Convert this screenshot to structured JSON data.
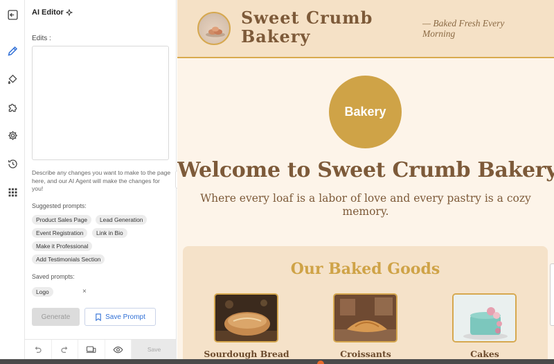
{
  "panel": {
    "title": "AI Editor",
    "edits_label": "Edits :",
    "edits_value": "",
    "help_text": "Describe any changes you want to make to the page here, and our AI Agent will make the changes for you!",
    "suggested_label": "Suggested prompts:",
    "suggested": [
      "Product Sales Page",
      "Lead Generation",
      "Event Registration",
      "Link in Bio",
      "Make it Professional",
      "Add Testimonials Section"
    ],
    "saved_label": "Saved prompts:",
    "saved": [
      "Logo"
    ],
    "generate_label": "Generate",
    "save_prompt_label": "Save Prompt",
    "toolbar_save_label": "Save"
  },
  "rail": {
    "icons": [
      "exit-panel-icon",
      "pencil-icon",
      "paint-bucket-icon",
      "puzzle-icon",
      "gear-icon",
      "history-icon",
      "apps-grid-icon"
    ]
  },
  "site": {
    "name_line1": "Sweet Crumb",
    "name_line2": "Bakery",
    "tagline": "— Baked Fresh Every Morning",
    "badge": "Bakery",
    "hero_title": "Welcome to Sweet Crumb Bakery",
    "hero_subtitle": "Where every loaf is a labor of love and every pastry is a cozy memory.",
    "goods_title": "Our Baked Goods",
    "goods": [
      "Sourdough Bread",
      "Croissants",
      "Cakes"
    ]
  },
  "colors": {
    "accent": "#cfa347",
    "brown": "#7d5a39",
    "header_bg": "#f5e1c6",
    "page_bg": "#fdf4e9",
    "link_blue": "#2f6fd6"
  }
}
